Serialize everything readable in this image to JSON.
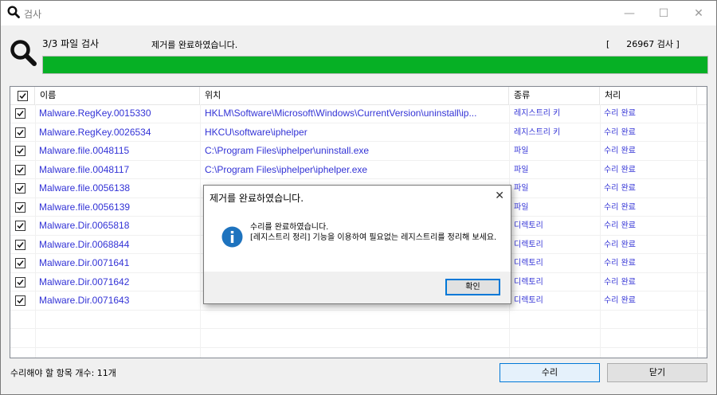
{
  "window": {
    "title": "검사",
    "minimize_icon": "minimize-icon",
    "maximize_icon": "maximize-icon",
    "close_icon": "close-icon"
  },
  "scan": {
    "step": "3/3 파일 검사",
    "status": "제거를 완료하였습니다.",
    "count_text": "[      26967 검사 ]",
    "progress": 1.0,
    "progress_color": "#06b025"
  },
  "table": {
    "columns": {
      "name": "이름",
      "location": "위치",
      "type": "종류",
      "action": "처리"
    },
    "rows": [
      {
        "checked": true,
        "name": "Malware.RegKey.0015330",
        "location": "HKLM\\Software\\Microsoft\\Windows\\CurrentVersion\\uninstall\\ip...",
        "type": "레지스트리 키",
        "action": "수리 완료"
      },
      {
        "checked": true,
        "name": "Malware.RegKey.0026534",
        "location": "HKCU\\software\\iphelper",
        "type": "레지스트리 키",
        "action": "수리 완료"
      },
      {
        "checked": true,
        "name": "Malware.file.0048115",
        "location": "C:\\Program Files\\iphelper\\uninstall.exe",
        "type": "파일",
        "action": "수리 완료"
      },
      {
        "checked": true,
        "name": "Malware.file.0048117",
        "location": "C:\\Program Files\\iphelper\\iphelper.exe",
        "type": "파일",
        "action": "수리 완료"
      },
      {
        "checked": true,
        "name": "Malware.file.0056138",
        "location": "",
        "type": "파일",
        "action": "수리 완료"
      },
      {
        "checked": true,
        "name": "Malware.file.0056139",
        "location": "",
        "type": "파일",
        "action": "수리 완료"
      },
      {
        "checked": true,
        "name": "Malware.Dir.0065818",
        "location": "",
        "type": "디렉토리",
        "action": "수리 완료"
      },
      {
        "checked": true,
        "name": "Malware.Dir.0068844",
        "location": "",
        "type": "디렉토리",
        "action": "수리 완료"
      },
      {
        "checked": true,
        "name": "Malware.Dir.0071641",
        "location": "",
        "type": "디렉토리",
        "action": "수리 완료"
      },
      {
        "checked": true,
        "name": "Malware.Dir.0071642",
        "location": "",
        "type": "디렉토리",
        "action": "수리 완료"
      },
      {
        "checked": true,
        "name": "Malware.Dir.0071643",
        "location": "",
        "type": "디렉토리",
        "action": "수리 완료"
      }
    ],
    "link_color": "#3333d6"
  },
  "footer": {
    "items_count": "수리해야 할 항목 개수: 11개",
    "repair_label": "수리",
    "close_label": "닫기"
  },
  "dialog": {
    "title": "제거를 완료하였습니다.",
    "line1": "수리를 완료하였습니다.",
    "line2": "[레지스트리 정리] 기능을 이용하여 필요없는 레지스트리를 정리해 보세요.",
    "ok_label": "확인",
    "icon": "info-icon",
    "icon_color": "#1e73be"
  }
}
